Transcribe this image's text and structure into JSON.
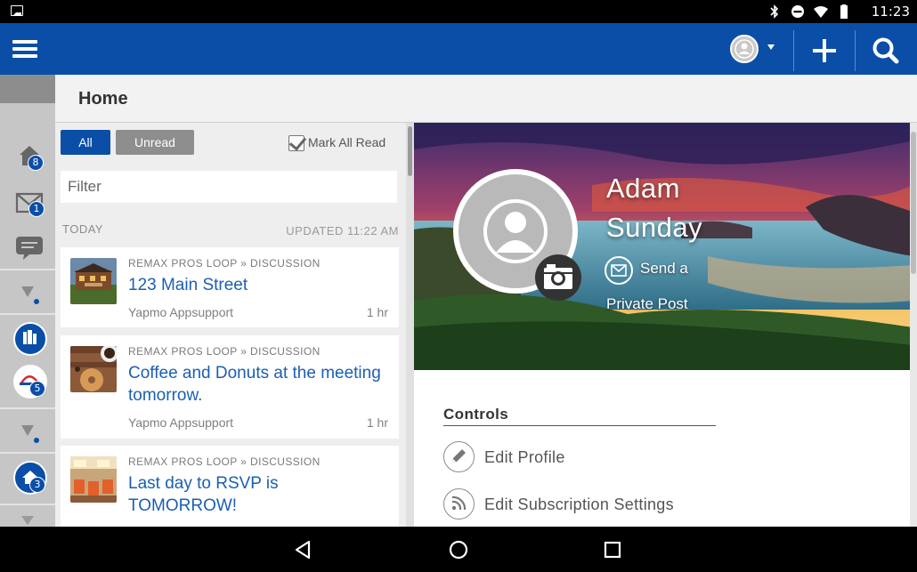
{
  "statusbar": {
    "time": "11:23"
  },
  "header": {
    "title": "Home"
  },
  "rail": {
    "badges": {
      "home": "8",
      "mail": "1",
      "remax": "5",
      "house": "3"
    }
  },
  "feed": {
    "filter_all": "All",
    "filter_unread": "Unread",
    "mark_all_read": "Mark All Read",
    "filter_placeholder": "Filter",
    "section_today": "TODAY",
    "updated": "UPDATED 11:22 AM",
    "items": [
      {
        "crumb": "REMAX PROS LOOP » DISCUSSION",
        "title": "123 Main Street",
        "author": "Yapmo Appsupport",
        "age": "1 hr"
      },
      {
        "crumb": "REMAX PROS LOOP » DISCUSSION",
        "title": "Coffee and Donuts at the meeting tomorrow.",
        "author": "Yapmo Appsupport",
        "age": "1 hr"
      },
      {
        "crumb": "REMAX PROS LOOP » DISCUSSION",
        "title": "Last day to RSVP is TOMORROW!",
        "author": "",
        "age": ""
      }
    ]
  },
  "profile": {
    "first_name": "Adam",
    "last_name": "Sunday",
    "send_line1": "Send a",
    "send_line2": "Private Post",
    "controls_title": "Controls",
    "controls": [
      {
        "label": "Edit Profile",
        "icon": "pencil-icon"
      },
      {
        "label": "Edit Subscription Settings",
        "icon": "rss-icon"
      }
    ]
  },
  "colors": {
    "brand": "#0a4ea8",
    "link": "#1b5fb3",
    "pill_inactive": "#8e8e8e"
  }
}
